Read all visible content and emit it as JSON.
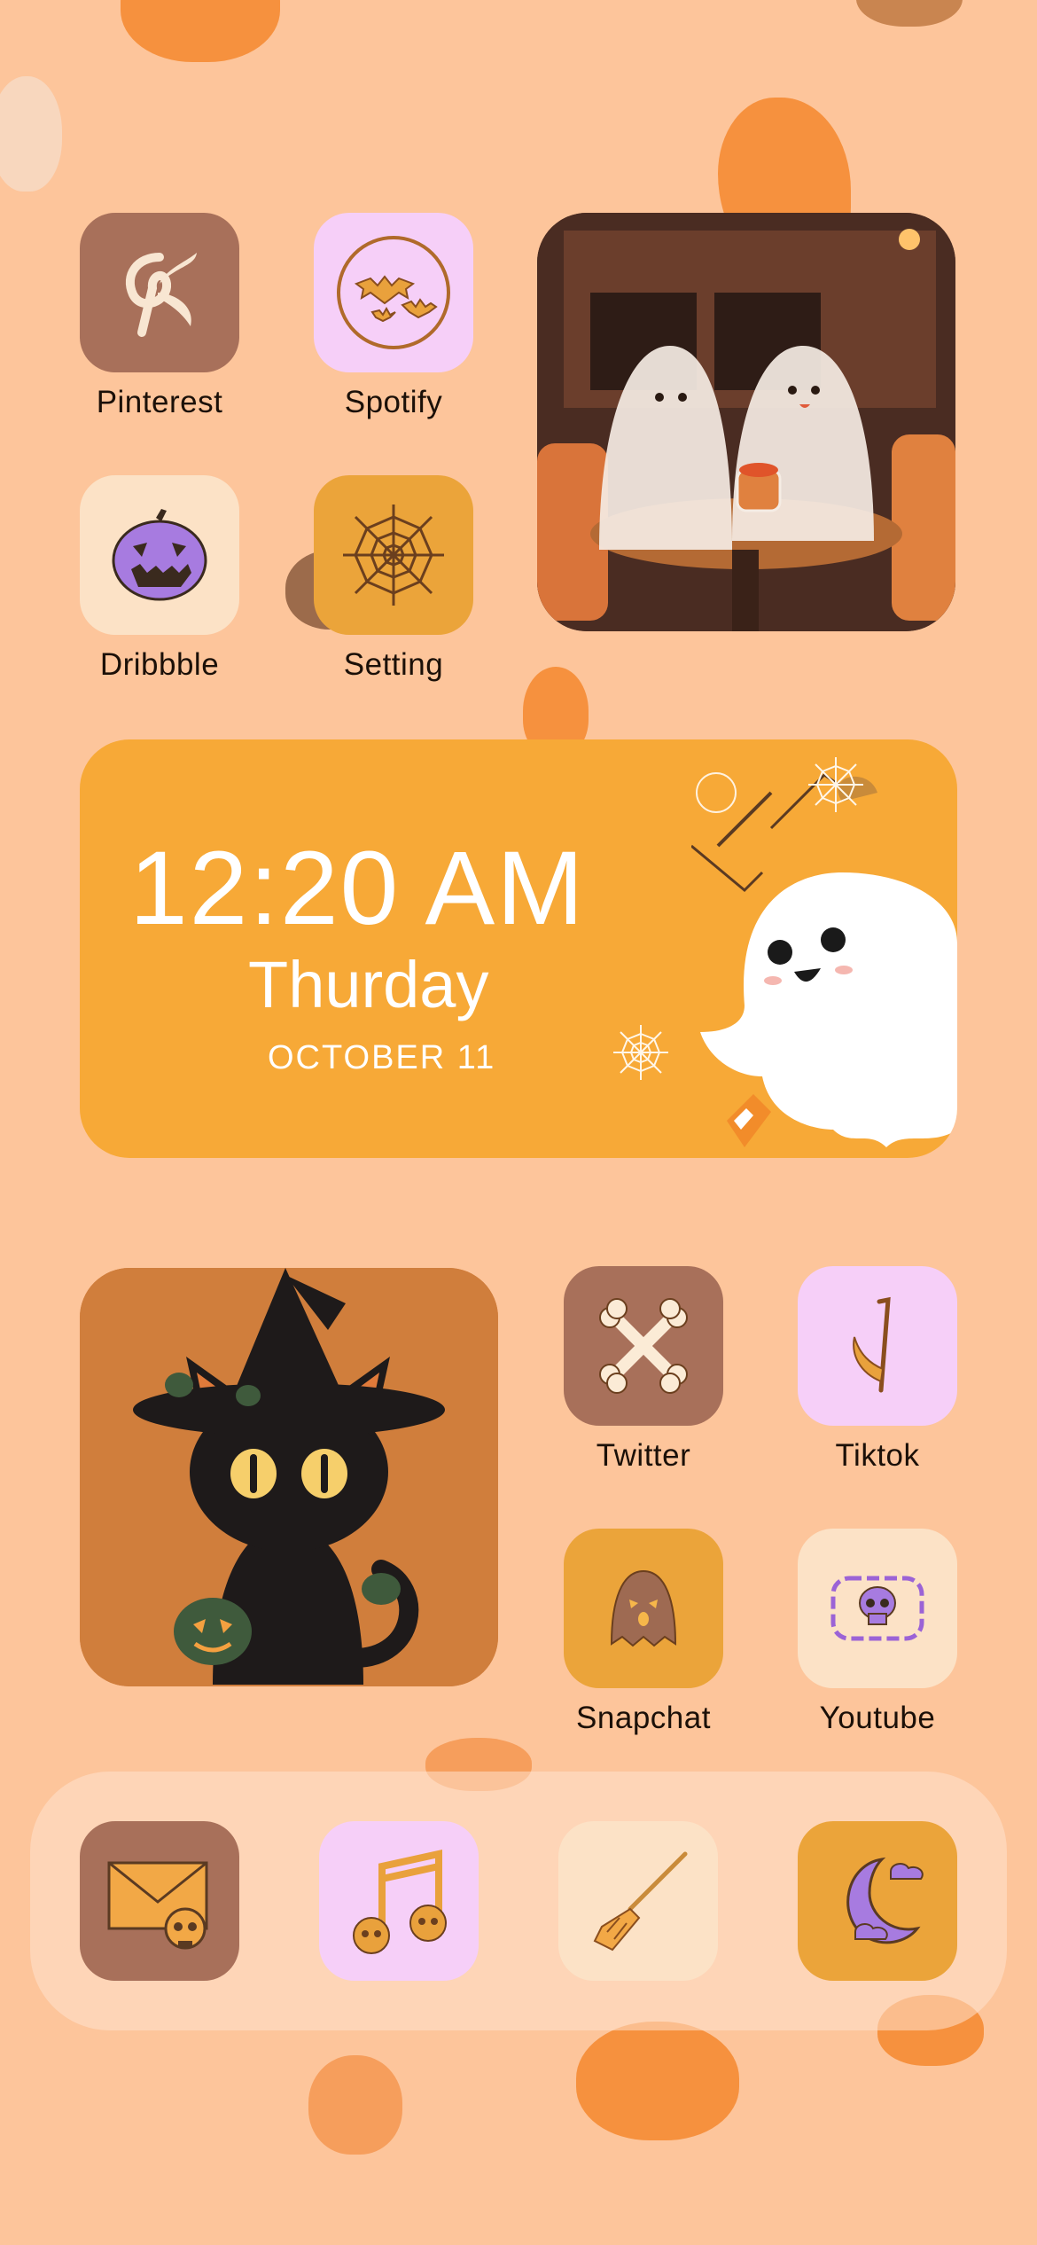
{
  "top_apps": [
    {
      "label": "Pinterest",
      "icon": "bow-icon",
      "tile_color": "#A8705A"
    },
    {
      "label": "Spotify",
      "icon": "bats-icon",
      "tile_color": "#F6CFF8"
    },
    {
      "label": "Dribbble",
      "icon": "jack-o-lantern-icon",
      "tile_color": "#FCE2C6"
    },
    {
      "label": "Setting",
      "icon": "spiderweb-icon",
      "tile_color": "#EBA43A"
    }
  ],
  "clock_widget": {
    "time": "12:20 AM",
    "day": "Thurday",
    "date": "OCTOBER 11"
  },
  "right_apps": [
    {
      "label": "Twitter",
      "icon": "crossbones-icon",
      "tile_color": "#A8705A"
    },
    {
      "label": "Tiktok",
      "icon": "scythe-icon",
      "tile_color": "#F6CFF8"
    },
    {
      "label": "Snapchat",
      "icon": "ghost-icon",
      "tile_color": "#EBA43A"
    },
    {
      "label": "Youtube",
      "icon": "skull-screen-icon",
      "tile_color": "#FCE2C6"
    }
  ],
  "dock": [
    {
      "icon": "mail-skull-icon",
      "tile_color": "#A8705A"
    },
    {
      "icon": "music-skulls-icon",
      "tile_color": "#F6CFF8"
    },
    {
      "icon": "broom-icon",
      "tile_color": "#FCE2C6"
    },
    {
      "icon": "moon-clouds-icon",
      "tile_color": "#EBA43A"
    }
  ]
}
